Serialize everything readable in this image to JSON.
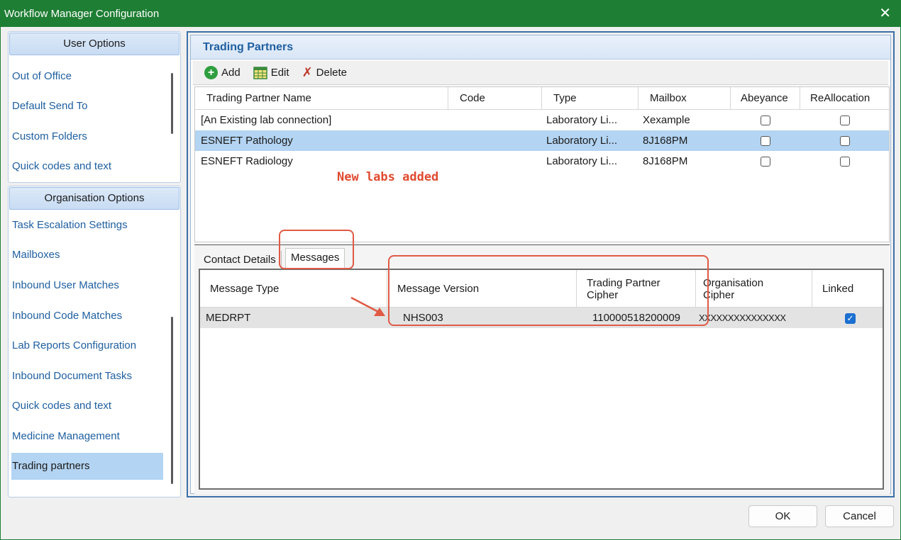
{
  "window": {
    "title": "Workflow Manager Configuration",
    "close_glyph": "✕"
  },
  "user_options": {
    "header": "User Options",
    "items": [
      "Out of Office",
      "Default Send To",
      "Custom Folders",
      "Quick codes and text"
    ]
  },
  "org_options": {
    "header": "Organisation Options",
    "items": [
      "Task Escalation Settings",
      "Mailboxes",
      "Inbound User Matches",
      "Inbound Code Matches",
      "Lab Reports Configuration",
      "Inbound Document Tasks",
      "Quick codes and text",
      "Medicine Management",
      "Trading partners"
    ],
    "selected_index": 8
  },
  "section_title": "Trading Partners",
  "toolbar": {
    "add": "Add",
    "edit": "Edit",
    "delete": "Delete"
  },
  "partners_grid": {
    "columns": [
      "Trading Partner Name",
      "Code",
      "Type",
      "Mailbox",
      "Abeyance",
      "ReAllocation"
    ],
    "rows": [
      {
        "name": "[An Existing lab connection]",
        "code": "",
        "type": "Laboratory Li...",
        "mailbox": "Xexample",
        "abeyance": false,
        "reallocation": false
      },
      {
        "name": "ESNEFT Pathology",
        "code": "",
        "type": "Laboratory Li...",
        "mailbox": "8J168PM",
        "abeyance": false,
        "reallocation": false
      },
      {
        "name": "ESNEFT Radiology",
        "code": "",
        "type": "Laboratory Li...",
        "mailbox": "8J168PM",
        "abeyance": false,
        "reallocation": false
      }
    ],
    "selected_index": 1
  },
  "annotation": "New labs added",
  "tabs": {
    "contact_details": "Contact Details",
    "messages": "Messages",
    "active": "Messages"
  },
  "messages_grid": {
    "columns": [
      "Message Type",
      "Message Version",
      "Trading Partner\nCipher",
      "Organisation\nCipher",
      "Linked"
    ],
    "rows": [
      {
        "type": "MEDRPT",
        "version": "NHS003",
        "tp_cipher": "110000518200009",
        "org_cipher": "XXXXXXXXXXXXXXX",
        "linked": true
      }
    ]
  },
  "buttons": {
    "ok": "OK",
    "cancel": "Cancel"
  },
  "colors": {
    "titlebar": "#1e7e34",
    "accent": "#1f5fa0",
    "selection": "#b3d4f2",
    "annotation": "#e04a2f"
  }
}
